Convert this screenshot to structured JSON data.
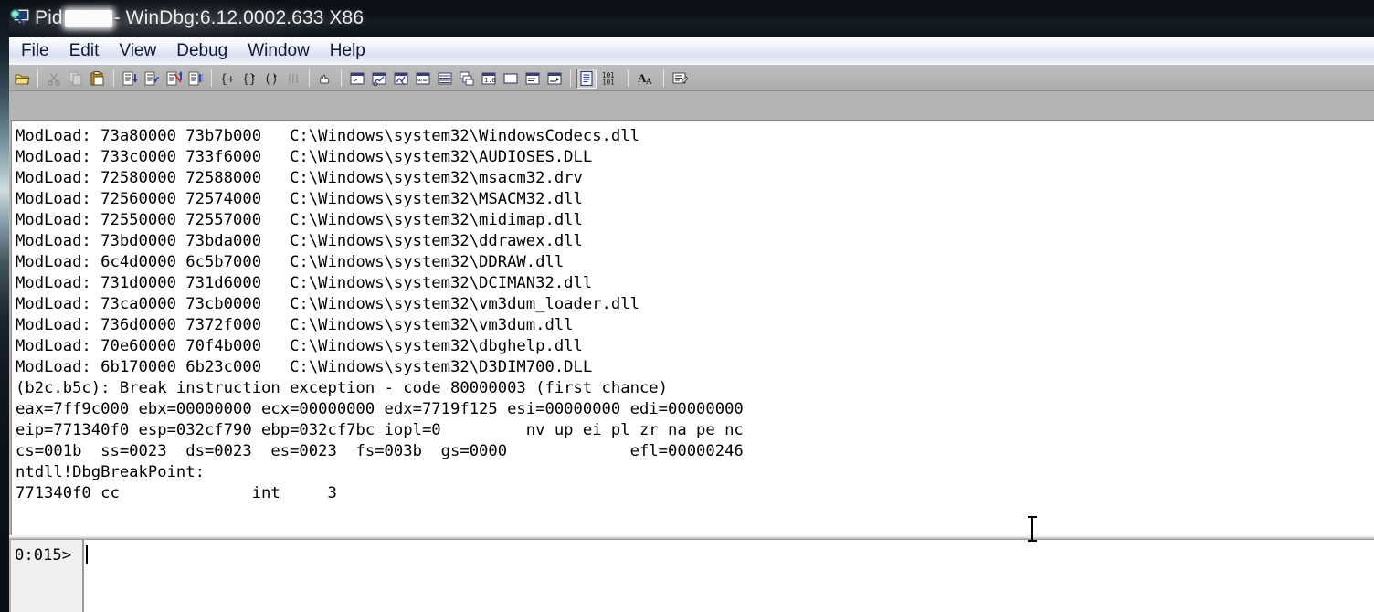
{
  "window": {
    "title_prefix": "Pid",
    "title_redacted": "",
    "title_suffix": "- WinDbg:6.12.0002.633 X86",
    "app_icon": "windbg-monitor-magnifier-icon"
  },
  "menu": {
    "items": [
      {
        "label": "File"
      },
      {
        "label": "Edit"
      },
      {
        "label": "View"
      },
      {
        "label": "Debug"
      },
      {
        "label": "Window"
      },
      {
        "label": "Help"
      }
    ]
  },
  "toolbar": {
    "buttons": [
      {
        "name": "open-executable-icon",
        "state": "enabled",
        "title": "Open Executable"
      },
      {
        "name": "separator",
        "state": "sep",
        "title": ""
      },
      {
        "name": "cut-icon",
        "state": "disabled",
        "title": "Cut"
      },
      {
        "name": "copy-icon",
        "state": "disabled",
        "title": "Copy"
      },
      {
        "name": "paste-icon",
        "state": "enabled",
        "title": "Paste"
      },
      {
        "name": "separator",
        "state": "sep",
        "title": ""
      },
      {
        "name": "step-into-icon",
        "state": "enabled",
        "title": "Step Into"
      },
      {
        "name": "step-over-icon",
        "state": "enabled",
        "title": "Step Over"
      },
      {
        "name": "step-out-icon",
        "state": "enabled",
        "title": "Step Out"
      },
      {
        "name": "run-to-cursor-icon",
        "state": "enabled",
        "title": "Run to Cursor"
      },
      {
        "name": "separator",
        "state": "sep",
        "title": ""
      },
      {
        "name": "go-icon",
        "state": "enabled",
        "title": "Go"
      },
      {
        "name": "go-handled-icon",
        "state": "enabled",
        "title": "Go Handled Exception"
      },
      {
        "name": "go-unhandled-icon",
        "state": "enabled",
        "title": "Go Unhandled Exception"
      },
      {
        "name": "restart-icon",
        "state": "disabled",
        "title": "Restart"
      },
      {
        "name": "separator",
        "state": "sep",
        "title": ""
      },
      {
        "name": "break-icon",
        "state": "enabled",
        "title": "Break"
      },
      {
        "name": "separator",
        "state": "sep",
        "title": ""
      },
      {
        "name": "command-window-icon",
        "state": "enabled",
        "title": "Command"
      },
      {
        "name": "watch-window-icon",
        "state": "enabled",
        "title": "Watch"
      },
      {
        "name": "locals-window-icon",
        "state": "enabled",
        "title": "Locals"
      },
      {
        "name": "registers-window-icon",
        "state": "enabled",
        "title": "Registers"
      },
      {
        "name": "memory-window-icon",
        "state": "enabled",
        "title": "Memory"
      },
      {
        "name": "callstack-window-icon",
        "state": "enabled",
        "title": "Call Stack"
      },
      {
        "name": "disassembly-window-icon",
        "state": "enabled",
        "title": "Disassembly"
      },
      {
        "name": "scratchpad-window-icon",
        "state": "enabled",
        "title": "Scratch Pad"
      },
      {
        "name": "processes-threads-icon",
        "state": "enabled",
        "title": "Processes and Threads"
      },
      {
        "name": "source-window-icon",
        "state": "enabled",
        "title": "Source"
      },
      {
        "name": "separator",
        "state": "sep",
        "title": ""
      },
      {
        "name": "command-active-icon",
        "state": "pressed",
        "title": "Command Window"
      },
      {
        "name": "numbers-icon",
        "state": "enabled",
        "title": "Source Line Numbers"
      },
      {
        "name": "separator",
        "state": "sep",
        "title": ""
      },
      {
        "name": "font-icon",
        "state": "enabled",
        "title": "Font"
      },
      {
        "name": "separator",
        "state": "sep",
        "title": ""
      },
      {
        "name": "options-icon",
        "state": "enabled",
        "title": "Options"
      }
    ]
  },
  "output": {
    "lines": [
      "ModLoad: 73a80000 73b7b000   C:\\Windows\\system32\\WindowsCodecs.dll",
      "ModLoad: 733c0000 733f6000   C:\\Windows\\system32\\AUDIOSES.DLL",
      "ModLoad: 72580000 72588000   C:\\Windows\\system32\\msacm32.drv",
      "ModLoad: 72560000 72574000   C:\\Windows\\system32\\MSACM32.dll",
      "ModLoad: 72550000 72557000   C:\\Windows\\system32\\midimap.dll",
      "ModLoad: 73bd0000 73bda000   C:\\Windows\\system32\\ddrawex.dll",
      "ModLoad: 6c4d0000 6c5b7000   C:\\Windows\\system32\\DDRAW.dll",
      "ModLoad: 731d0000 731d6000   C:\\Windows\\system32\\DCIMAN32.dll",
      "ModLoad: 73ca0000 73cb0000   C:\\Windows\\system32\\vm3dum_loader.dll",
      "ModLoad: 736d0000 7372f000   C:\\Windows\\system32\\vm3dum.dll",
      "ModLoad: 70e60000 70f4b000   C:\\Windows\\system32\\dbghelp.dll",
      "ModLoad: 6b170000 6b23c000   C:\\Windows\\system32\\D3DIM700.DLL",
      "(b2c.b5c): Break instruction exception - code 80000003 (first chance)",
      "eax=7ff9c000 ebx=00000000 ecx=00000000 edx=7719f125 esi=00000000 edi=00000000",
      "eip=771340f0 esp=032cf790 ebp=032cf7bc iopl=0         nv up ei pl zr na pe nc",
      "cs=001b  ss=0023  ds=0023  es=0023  fs=003b  gs=0000             efl=00000246",
      "ntdll!DbgBreakPoint:",
      "771340f0 cc              int     3"
    ]
  },
  "prompt": {
    "label": "0:015>",
    "value": "",
    "placeholder": ""
  },
  "colors": {
    "titlebar": "#0d1117",
    "menubar": "#dadff1",
    "toolbar": "#b6b6b6",
    "mdi_background": "#b3b3b3",
    "pane_background": "#ffffff",
    "text": "#000000",
    "prompt_label_background": "#f0f0f0"
  }
}
